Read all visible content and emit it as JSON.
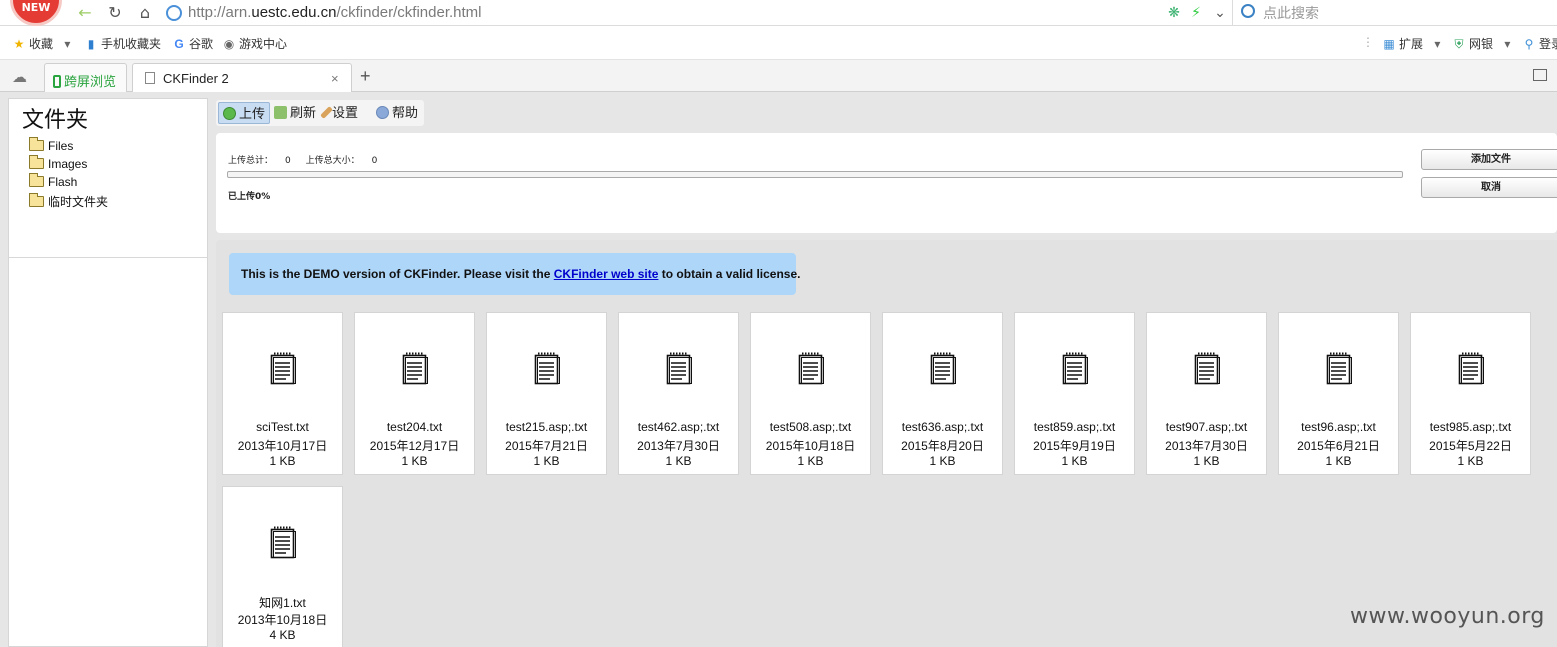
{
  "browser": {
    "badge": "NEW",
    "url_prefix": "http://arn.",
    "url_host": "uestc.edu.cn",
    "url_path": "/ckfinder/ckfinder.html",
    "search_placeholder": "点此搜索",
    "bookmarks": [
      "收藏",
      "手机收藏夹",
      "谷歌",
      "游戏中心"
    ],
    "right_tools": [
      "扩展",
      "网银",
      "登录"
    ],
    "tabs": [
      {
        "label": "跨屏浏览"
      },
      {
        "label": "CKFinder 2"
      }
    ],
    "close_glyph": "×",
    "newtab_glyph": "+"
  },
  "folders": {
    "title": "文件夹",
    "items": [
      "Files",
      "Images",
      "Flash",
      "临时文件夹"
    ]
  },
  "toolbar": {
    "upload": "上传",
    "refresh": "刷新",
    "settings": "设置",
    "help": "帮助"
  },
  "upload_panel": {
    "total_label": "上传总计：",
    "total_value": "0",
    "size_label": "上传总大小：",
    "size_value": "0",
    "progress_text": "已上传0%",
    "progress": 0,
    "add_button": "添加文件",
    "cancel_button": "取消"
  },
  "demo_notice": {
    "before": "This is the DEMO version of CKFinder. Please visit the ",
    "link": "CKFinder web site",
    "after": " to obtain a valid license."
  },
  "files": [
    {
      "name": "sciTest.txt",
      "date": "2013年10月17日",
      "size": "1 KB"
    },
    {
      "name": "test204.txt",
      "date": "2015年12月17日",
      "size": "1 KB"
    },
    {
      "name": "test215.asp;.txt",
      "date": "2015年7月21日",
      "size": "1 KB"
    },
    {
      "name": "test462.asp;.txt",
      "date": "2013年7月30日",
      "size": "1 KB"
    },
    {
      "name": "test508.asp;.txt",
      "date": "2015年10月18日",
      "size": "1 KB"
    },
    {
      "name": "test636.asp;.txt",
      "date": "2015年8月20日",
      "size": "1 KB"
    },
    {
      "name": "test859.asp;.txt",
      "date": "2015年9月19日",
      "size": "1 KB"
    },
    {
      "name": "test907.asp;.txt",
      "date": "2013年7月30日",
      "size": "1 KB"
    },
    {
      "name": "test96.asp;.txt",
      "date": "2015年6月21日",
      "size": "1 KB"
    },
    {
      "name": "test985.asp;.txt",
      "date": "2015年5月22日",
      "size": "1 KB"
    },
    {
      "name": "知网1.txt",
      "date": "2013年10月18日",
      "size": "4 KB"
    }
  ],
  "watermark": "www.wooyun.org",
  "colors": {
    "badge": "#e53b35",
    "notice_bg": "#aed6f9",
    "link": "#0000cc",
    "active_tool": "#c8dcf2"
  }
}
